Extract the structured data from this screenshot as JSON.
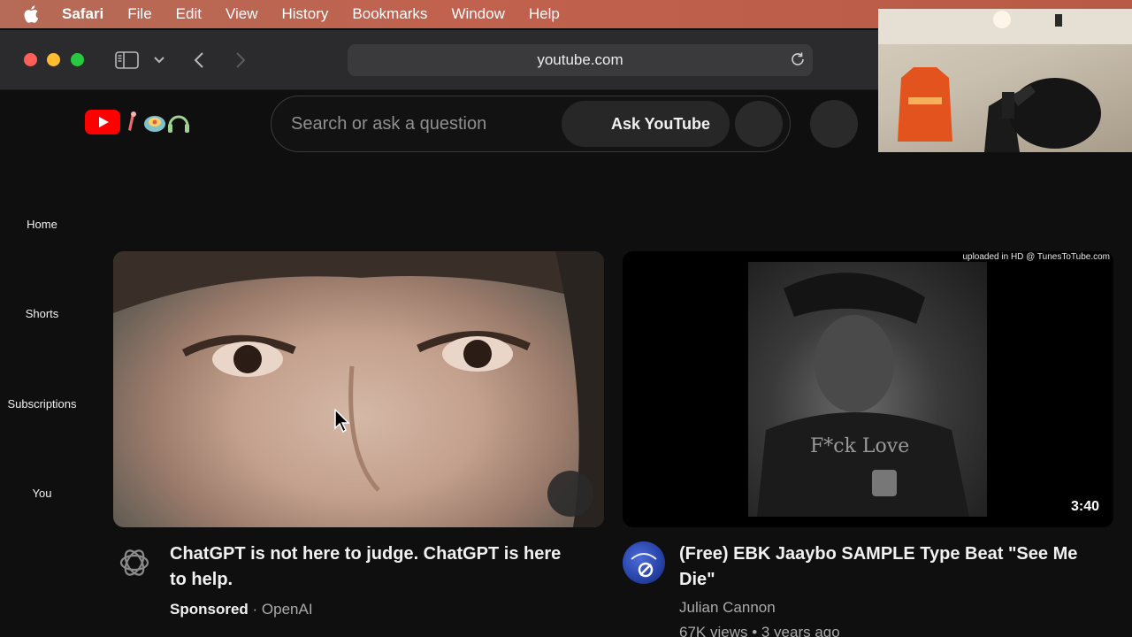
{
  "menubar": {
    "app": "Safari",
    "items": [
      "File",
      "Edit",
      "View",
      "History",
      "Bookmarks",
      "Window",
      "Help"
    ]
  },
  "toolbar": {
    "url": "youtube.com"
  },
  "header": {
    "search_placeholder": "Search or ask a question",
    "ask_button": "Ask YouTube"
  },
  "sidebar": {
    "items": [
      {
        "label": "Home"
      },
      {
        "label": "Shorts"
      },
      {
        "label": "Subscriptions"
      },
      {
        "label": "You"
      }
    ]
  },
  "videos": [
    {
      "title": "ChatGPT is not here to judge. ChatGPT is here to help.",
      "sponsored": "Sponsored",
      "channel": "OpenAI"
    },
    {
      "title": "(Free) EBK Jaaybo SAMPLE Type Beat \"See Me Die\"",
      "channel": "Julian Cannon",
      "stats": "67K views • 3 years ago",
      "duration": "3:40",
      "watermark": "uploaded in HD @ TunesToTube.com",
      "thumb_text": "F*ck Love"
    }
  ],
  "colors": {
    "yt_red": "#ff0000",
    "menubar": "#c0624e",
    "background": "#0f0f0f"
  }
}
